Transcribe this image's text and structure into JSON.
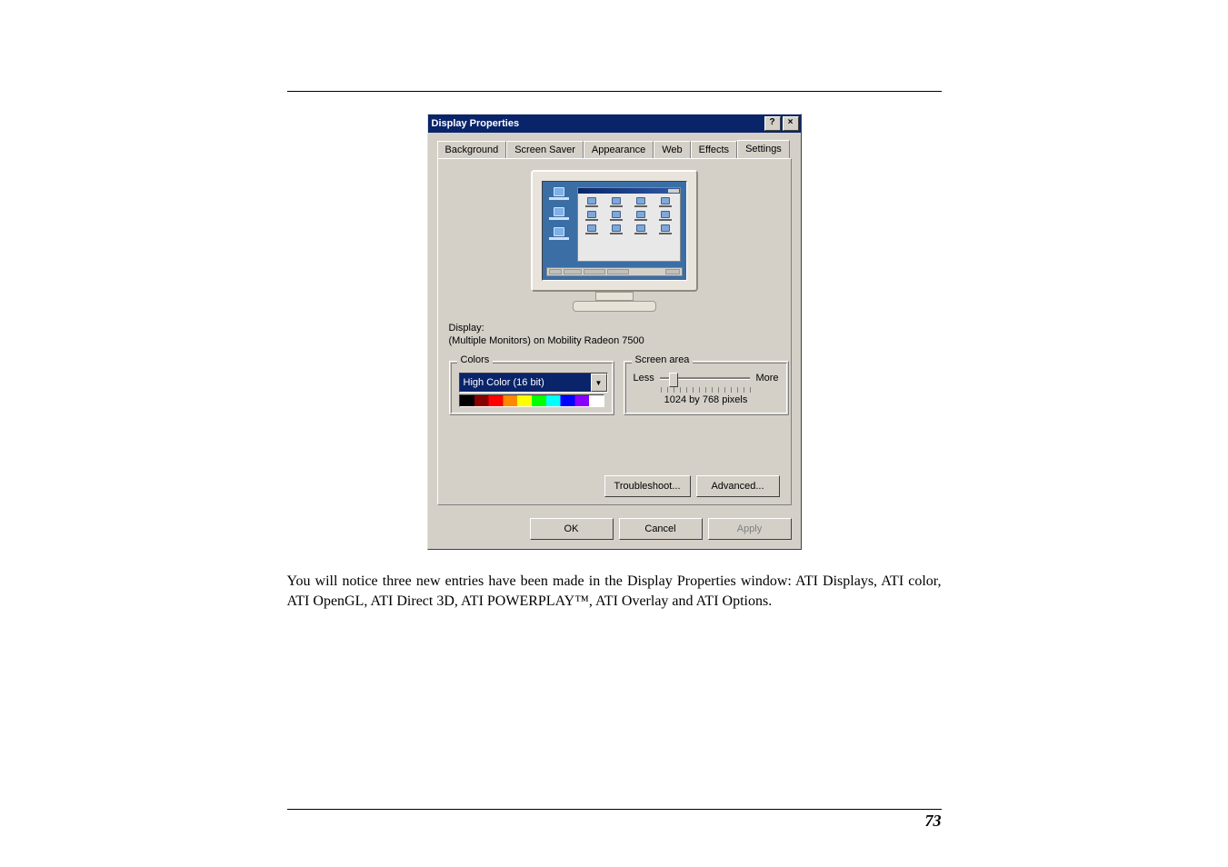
{
  "dialog": {
    "title": "Display Properties",
    "help_char": "?",
    "close_char": "×",
    "tabs": [
      {
        "label": "Background"
      },
      {
        "label": "Screen Saver"
      },
      {
        "label": "Appearance"
      },
      {
        "label": "Web"
      },
      {
        "label": "Effects"
      },
      {
        "label": "Settings"
      }
    ],
    "display_label": "Display:",
    "display_name": "(Multiple Monitors) on Mobility Radeon 7500",
    "colors": {
      "group_title": "Colors",
      "combo_value": "High Color (16 bit)"
    },
    "screen_area": {
      "group_title": "Screen area",
      "less": "Less",
      "more": "More",
      "resolution": "1024 by 768 pixels"
    },
    "buttons": {
      "troubleshoot": "Troubleshoot...",
      "advanced": "Advanced...",
      "ok": "OK",
      "cancel": "Cancel",
      "apply": "Apply"
    }
  },
  "caption": "You will notice three new entries have been made in the Display Properties window: ATI Displays, ATI color, ATI OpenGL, ATI Direct 3D, ATI POWERPLAY™, ATI Overlay and ATI Options.",
  "page_number": "73"
}
